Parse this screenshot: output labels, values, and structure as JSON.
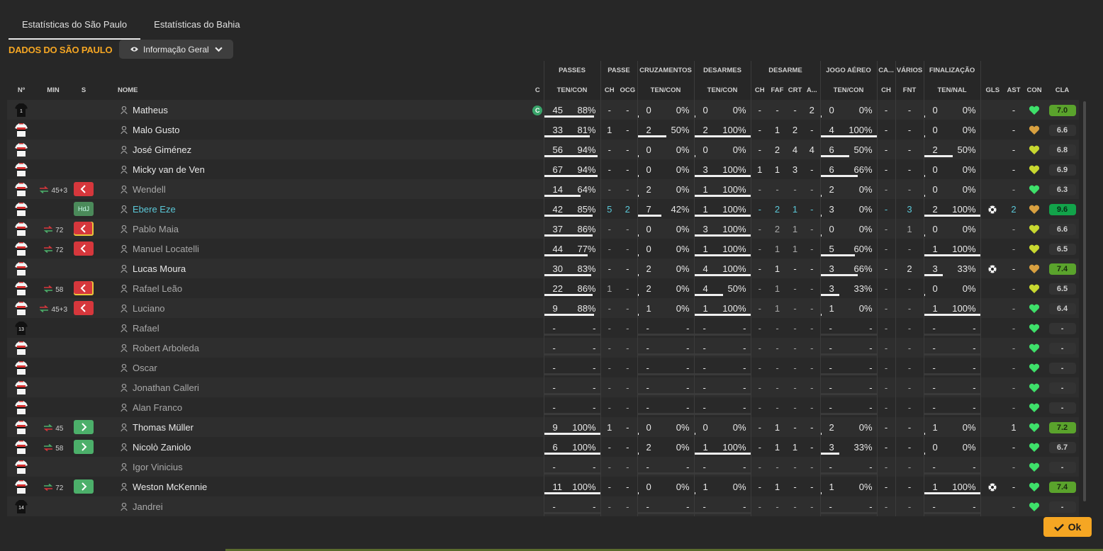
{
  "tabs": [
    "Estatísticas do São Paulo",
    "Estatísticas do Bahia"
  ],
  "section_title": "DADOS DO SÃO PAULO",
  "view_dropdown": "Informação Geral",
  "groups": [
    "PASSES",
    "PASSE",
    "CRUZAMENTOS",
    "DESARMES",
    "DESARME",
    "JOGO AÉREO",
    "CA...",
    "VÁRIOS",
    "FINALIZAÇÃO"
  ],
  "columns": {
    "num": "Nº",
    "min": "MIN",
    "s": "S",
    "name": "NOME",
    "c": "C",
    "passes": "TEN/CON",
    "passe_ch": "CH",
    "passe_ocg": "OCG",
    "cruz": "TEN/CON",
    "desarmes": "TEN/CON",
    "des_ch": "CH",
    "des_faf": "FAF",
    "des_crt": "CRT",
    "des_a": "A...",
    "aereo": "TEN/CON",
    "ca_ch": "CH",
    "fnt": "FNT",
    "final": "TEN/NAL",
    "gls": "GLS",
    "ast": "AST",
    "con": "CON",
    "cla": "CLA"
  },
  "players": [
    {
      "kit": "gk",
      "kitnum": "1",
      "arrow": "",
      "min": "",
      "sub": "",
      "name": "Matheus",
      "style": "",
      "cap": "C",
      "p1": "45",
      "p2": "88%",
      "pb": 88,
      "ch": "-",
      "ocg": "-",
      "c1": "0",
      "c2": "0%",
      "cb": 0,
      "d1": "0",
      "d2": "0%",
      "db": 0,
      "dch": "-",
      "faf": "-",
      "crt": "-",
      "da": "2",
      "a1": "0",
      "a2": "0%",
      "ab": 0,
      "cach": "-",
      "fnt": "-",
      "f1": "0",
      "f2": "0%",
      "fb": 0,
      "gls": "",
      "ast": "-",
      "con": "green",
      "cla": "7.0",
      "clac": "green"
    },
    {
      "kit": "out",
      "kitnum": "",
      "arrow": "",
      "min": "",
      "sub": "",
      "name": "Malo Gusto",
      "style": "",
      "cap": "",
      "p1": "33",
      "p2": "81%",
      "pb": 81,
      "ch": "1",
      "ocg": "-",
      "c1": "2",
      "c2": "50%",
      "cb": 50,
      "d1": "2",
      "d2": "100%",
      "db": 100,
      "dch": "-",
      "faf": "1",
      "crt": "2",
      "da": "-",
      "a1": "4",
      "a2": "100%",
      "ab": 100,
      "cach": "-",
      "fnt": "-",
      "f1": "0",
      "f2": "0%",
      "fb": 0,
      "gls": "",
      "ast": "-",
      "con": "orange",
      "cla": "6.6",
      "clac": "grey"
    },
    {
      "kit": "out",
      "kitnum": "",
      "arrow": "",
      "min": "",
      "sub": "",
      "name": "José Giménez",
      "style": "",
      "cap": "",
      "p1": "56",
      "p2": "94%",
      "pb": 94,
      "ch": "-",
      "ocg": "-",
      "c1": "0",
      "c2": "0%",
      "cb": 0,
      "d1": "0",
      "d2": "0%",
      "db": 0,
      "dch": "-",
      "faf": "2",
      "crt": "4",
      "da": "4",
      "a1": "6",
      "a2": "50%",
      "ab": 50,
      "cach": "-",
      "fnt": "-",
      "f1": "2",
      "f2": "50%",
      "fb": 50,
      "gls": "",
      "ast": "-",
      "con": "yellow",
      "cla": "6.8",
      "clac": "grey"
    },
    {
      "kit": "out",
      "kitnum": "",
      "arrow": "",
      "min": "",
      "sub": "",
      "name": "Micky van de Ven",
      "style": "",
      "cap": "",
      "p1": "67",
      "p2": "94%",
      "pb": 94,
      "ch": "-",
      "ocg": "-",
      "c1": "0",
      "c2": "0%",
      "cb": 0,
      "d1": "3",
      "d2": "100%",
      "db": 100,
      "dch": "1",
      "faf": "1",
      "crt": "3",
      "da": "-",
      "a1": "6",
      "a2": "66%",
      "ab": 66,
      "cach": "-",
      "fnt": "-",
      "f1": "0",
      "f2": "0%",
      "fb": 0,
      "gls": "",
      "ast": "-",
      "con": "yellow",
      "cla": "6.9",
      "clac": "grey"
    },
    {
      "kit": "out",
      "kitnum": "",
      "arrow": "red",
      "min": "45+3",
      "sub": "out",
      "name": "Wendell",
      "style": "dim",
      "cap": "",
      "p1": "14",
      "p2": "64%",
      "pb": 64,
      "ch": "-",
      "ocg": "-",
      "c1": "2",
      "c2": "0%",
      "cb": 0,
      "d1": "1",
      "d2": "100%",
      "db": 100,
      "dch": "-",
      "faf": "-",
      "crt": "-",
      "da": "-",
      "a1": "2",
      "a2": "0%",
      "ab": 0,
      "cach": "-",
      "fnt": "-",
      "f1": "0",
      "f2": "0%",
      "fb": 0,
      "gls": "",
      "ast": "-",
      "con": "green",
      "cla": "6.3",
      "clac": "grey"
    },
    {
      "kit": "out",
      "kitnum": "",
      "arrow": "",
      "min": "",
      "sub": "hdj",
      "name": "Ebere Eze",
      "style": "cyan",
      "cap": "",
      "p1": "42",
      "p2": "85%",
      "pb": 85,
      "ch": "5",
      "ocg": "2",
      "c1": "7",
      "c2": "42%",
      "cb": 42,
      "d1": "1",
      "d2": "100%",
      "db": 100,
      "dch": "-",
      "faf": "2",
      "crt": "1",
      "da": "-",
      "a1": "3",
      "a2": "0%",
      "ab": 0,
      "cach": "-",
      "fnt": "3",
      "f1": "2",
      "f2": "100%",
      "fb": 100,
      "gls": "ball",
      "ast": "2",
      "con": "orange",
      "cla": "9.6",
      "clac": "green2"
    },
    {
      "kit": "out",
      "kitnum": "",
      "arrow": "red",
      "min": "72",
      "sub": "out-yc",
      "name": "Pablo Maia",
      "style": "dim",
      "cap": "",
      "p1": "37",
      "p2": "86%",
      "pb": 86,
      "ch": "-",
      "ocg": "-",
      "c1": "0",
      "c2": "0%",
      "cb": 0,
      "d1": "3",
      "d2": "100%",
      "db": 100,
      "dch": "-",
      "faf": "2",
      "crt": "1",
      "da": "-",
      "a1": "0",
      "a2": "0%",
      "ab": 0,
      "cach": "-",
      "fnt": "1",
      "f1": "0",
      "f2": "0%",
      "fb": 0,
      "gls": "",
      "ast": "-",
      "con": "yellow",
      "cla": "6.6",
      "clac": "grey"
    },
    {
      "kit": "out",
      "kitnum": "",
      "arrow": "red",
      "min": "72",
      "sub": "out",
      "name": "Manuel Locatelli",
      "style": "dim",
      "cap": "",
      "p1": "44",
      "p2": "77%",
      "pb": 77,
      "ch": "-",
      "ocg": "-",
      "c1": "0",
      "c2": "0%",
      "cb": 0,
      "d1": "1",
      "d2": "100%",
      "db": 100,
      "dch": "-",
      "faf": "1",
      "crt": "1",
      "da": "-",
      "a1": "5",
      "a2": "60%",
      "ab": 60,
      "cach": "-",
      "fnt": "-",
      "f1": "1",
      "f2": "100%",
      "fb": 100,
      "gls": "",
      "ast": "-",
      "con": "yellow",
      "cla": "6.5",
      "clac": "grey"
    },
    {
      "kit": "out",
      "kitnum": "",
      "arrow": "",
      "min": "",
      "sub": "",
      "name": "Lucas Moura",
      "style": "",
      "cap": "",
      "p1": "30",
      "p2": "83%",
      "pb": 83,
      "ch": "-",
      "ocg": "-",
      "c1": "2",
      "c2": "0%",
      "cb": 0,
      "d1": "4",
      "d2": "100%",
      "db": 100,
      "dch": "-",
      "faf": "1",
      "crt": "-",
      "da": "-",
      "a1": "3",
      "a2": "66%",
      "ab": 66,
      "cach": "-",
      "fnt": "2",
      "f1": "3",
      "f2": "33%",
      "fb": 33,
      "gls": "ball",
      "ast": "-",
      "con": "orange",
      "cla": "7.4",
      "clac": "green"
    },
    {
      "kit": "out",
      "kitnum": "",
      "arrow": "red",
      "min": "58",
      "sub": "out-yc",
      "name": "Rafael Leão",
      "style": "dim",
      "cap": "",
      "p1": "22",
      "p2": "86%",
      "pb": 86,
      "ch": "1",
      "ocg": "-",
      "c1": "2",
      "c2": "0%",
      "cb": 0,
      "d1": "4",
      "d2": "50%",
      "db": 50,
      "dch": "-",
      "faf": "1",
      "crt": "-",
      "da": "-",
      "a1": "3",
      "a2": "33%",
      "ab": 33,
      "cach": "-",
      "fnt": "-",
      "f1": "0",
      "f2": "0%",
      "fb": 0,
      "gls": "",
      "ast": "-",
      "con": "yellow",
      "cla": "6.5",
      "clac": "grey"
    },
    {
      "kit": "out",
      "kitnum": "",
      "arrow": "red",
      "min": "45+3",
      "sub": "out",
      "name": "Luciano",
      "style": "dim",
      "cap": "",
      "p1": "9",
      "p2": "88%",
      "pb": 88,
      "ch": "-",
      "ocg": "-",
      "c1": "1",
      "c2": "0%",
      "cb": 0,
      "d1": "1",
      "d2": "100%",
      "db": 100,
      "dch": "-",
      "faf": "1",
      "crt": "-",
      "da": "-",
      "a1": "1",
      "a2": "0%",
      "ab": 0,
      "cach": "-",
      "fnt": "-",
      "f1": "1",
      "f2": "100%",
      "fb": 100,
      "gls": "",
      "ast": "-",
      "con": "green",
      "cla": "6.4",
      "clac": "grey"
    },
    {
      "kit": "gk",
      "kitnum": "13",
      "arrow": "",
      "min": "",
      "sub": "",
      "name": "Rafael",
      "style": "dim",
      "cap": "",
      "p1": "-",
      "p2": "-",
      "pb": 0,
      "ch": "-",
      "ocg": "-",
      "c1": "-",
      "c2": "-",
      "cb": 0,
      "d1": "-",
      "d2": "-",
      "db": 0,
      "dch": "-",
      "faf": "-",
      "crt": "-",
      "da": "-",
      "a1": "-",
      "a2": "-",
      "ab": 0,
      "cach": "-",
      "fnt": "-",
      "f1": "-",
      "f2": "-",
      "fb": 0,
      "gls": "",
      "ast": "-",
      "con": "green",
      "cla": "-",
      "clac": "grey"
    },
    {
      "kit": "out",
      "kitnum": "",
      "arrow": "",
      "min": "",
      "sub": "",
      "name": "Robert Arboleda",
      "style": "dim",
      "cap": "",
      "p1": "-",
      "p2": "-",
      "pb": 0,
      "ch": "-",
      "ocg": "-",
      "c1": "-",
      "c2": "-",
      "cb": 0,
      "d1": "-",
      "d2": "-",
      "db": 0,
      "dch": "-",
      "faf": "-",
      "crt": "-",
      "da": "-",
      "a1": "-",
      "a2": "-",
      "ab": 0,
      "cach": "-",
      "fnt": "-",
      "f1": "-",
      "f2": "-",
      "fb": 0,
      "gls": "",
      "ast": "-",
      "con": "green",
      "cla": "-",
      "clac": "grey"
    },
    {
      "kit": "out",
      "kitnum": "",
      "arrow": "",
      "min": "",
      "sub": "",
      "name": "Oscar",
      "style": "dim",
      "cap": "",
      "p1": "-",
      "p2": "-",
      "pb": 0,
      "ch": "-",
      "ocg": "-",
      "c1": "-",
      "c2": "-",
      "cb": 0,
      "d1": "-",
      "d2": "-",
      "db": 0,
      "dch": "-",
      "faf": "-",
      "crt": "-",
      "da": "-",
      "a1": "-",
      "a2": "-",
      "ab": 0,
      "cach": "-",
      "fnt": "-",
      "f1": "-",
      "f2": "-",
      "fb": 0,
      "gls": "",
      "ast": "-",
      "con": "green",
      "cla": "-",
      "clac": "grey"
    },
    {
      "kit": "out",
      "kitnum": "",
      "arrow": "",
      "min": "",
      "sub": "",
      "name": "Jonathan Calleri",
      "style": "dim",
      "cap": "",
      "p1": "-",
      "p2": "-",
      "pb": 0,
      "ch": "-",
      "ocg": "-",
      "c1": "-",
      "c2": "-",
      "cb": 0,
      "d1": "-",
      "d2": "-",
      "db": 0,
      "dch": "-",
      "faf": "-",
      "crt": "-",
      "da": "-",
      "a1": "-",
      "a2": "-",
      "ab": 0,
      "cach": "-",
      "fnt": "-",
      "f1": "-",
      "f2": "-",
      "fb": 0,
      "gls": "",
      "ast": "-",
      "con": "green",
      "cla": "-",
      "clac": "grey"
    },
    {
      "kit": "out",
      "kitnum": "",
      "arrow": "",
      "min": "",
      "sub": "",
      "name": "Alan Franco",
      "style": "dim",
      "cap": "",
      "p1": "-",
      "p2": "-",
      "pb": 0,
      "ch": "-",
      "ocg": "-",
      "c1": "-",
      "c2": "-",
      "cb": 0,
      "d1": "-",
      "d2": "-",
      "db": 0,
      "dch": "-",
      "faf": "-",
      "crt": "-",
      "da": "-",
      "a1": "-",
      "a2": "-",
      "ab": 0,
      "cach": "-",
      "fnt": "-",
      "f1": "-",
      "f2": "-",
      "fb": 0,
      "gls": "",
      "ast": "-",
      "con": "green",
      "cla": "-",
      "clac": "grey"
    },
    {
      "kit": "out",
      "kitnum": "",
      "arrow": "green",
      "min": "45",
      "sub": "in",
      "name": "Thomas Müller",
      "style": "",
      "cap": "",
      "p1": "9",
      "p2": "100%",
      "pb": 100,
      "ch": "1",
      "ocg": "-",
      "c1": "0",
      "c2": "0%",
      "cb": 0,
      "d1": "0",
      "d2": "0%",
      "db": 0,
      "dch": "-",
      "faf": "1",
      "crt": "-",
      "da": "-",
      "a1": "2",
      "a2": "0%",
      "ab": 0,
      "cach": "-",
      "fnt": "-",
      "f1": "1",
      "f2": "0%",
      "fb": 0,
      "gls": "",
      "ast": "1",
      "con": "green",
      "cla": "7.2",
      "clac": "green"
    },
    {
      "kit": "out",
      "kitnum": "",
      "arrow": "green",
      "min": "58",
      "sub": "in",
      "name": "Nicolò Zaniolo",
      "style": "",
      "cap": "",
      "p1": "6",
      "p2": "100%",
      "pb": 100,
      "ch": "-",
      "ocg": "-",
      "c1": "2",
      "c2": "0%",
      "cb": 0,
      "d1": "1",
      "d2": "100%",
      "db": 100,
      "dch": "-",
      "faf": "1",
      "crt": "1",
      "da": "-",
      "a1": "3",
      "a2": "33%",
      "ab": 33,
      "cach": "-",
      "fnt": "-",
      "f1": "0",
      "f2": "0%",
      "fb": 0,
      "gls": "",
      "ast": "-",
      "con": "green",
      "cla": "6.7",
      "clac": "grey"
    },
    {
      "kit": "out",
      "kitnum": "",
      "arrow": "",
      "min": "",
      "sub": "",
      "name": "Igor Vinicius",
      "style": "dim",
      "cap": "",
      "p1": "-",
      "p2": "-",
      "pb": 0,
      "ch": "-",
      "ocg": "-",
      "c1": "-",
      "c2": "-",
      "cb": 0,
      "d1": "-",
      "d2": "-",
      "db": 0,
      "dch": "-",
      "faf": "-",
      "crt": "-",
      "da": "-",
      "a1": "-",
      "a2": "-",
      "ab": 0,
      "cach": "-",
      "fnt": "-",
      "f1": "-",
      "f2": "-",
      "fb": 0,
      "gls": "",
      "ast": "-",
      "con": "green",
      "cla": "-",
      "clac": "grey"
    },
    {
      "kit": "out",
      "kitnum": "",
      "arrow": "green",
      "min": "72",
      "sub": "in",
      "name": "Weston McKennie",
      "style": "",
      "cap": "",
      "p1": "11",
      "p2": "100%",
      "pb": 100,
      "ch": "-",
      "ocg": "-",
      "c1": "0",
      "c2": "0%",
      "cb": 0,
      "d1": "1",
      "d2": "0%",
      "db": 0,
      "dch": "-",
      "faf": "1",
      "crt": "-",
      "da": "-",
      "a1": "1",
      "a2": "0%",
      "ab": 0,
      "cach": "-",
      "fnt": "-",
      "f1": "1",
      "f2": "100%",
      "fb": 100,
      "gls": "ball",
      "ast": "-",
      "con": "green",
      "cla": "7.4",
      "clac": "green"
    },
    {
      "kit": "gk",
      "kitnum": "14",
      "arrow": "",
      "min": "",
      "sub": "",
      "name": "Jandrei",
      "style": "dim",
      "cap": "",
      "p1": "-",
      "p2": "-",
      "pb": 0,
      "ch": "-",
      "ocg": "-",
      "c1": "-",
      "c2": "-",
      "cb": 0,
      "d1": "-",
      "d2": "-",
      "db": 0,
      "dch": "-",
      "faf": "-",
      "crt": "-",
      "da": "-",
      "a1": "-",
      "a2": "-",
      "ab": 0,
      "cach": "-",
      "fnt": "-",
      "f1": "-",
      "f2": "-",
      "fb": 0,
      "gls": "",
      "ast": "-",
      "con": "green",
      "cla": "-",
      "clac": "grey"
    }
  ],
  "ok_label": "Ok",
  "colors": {
    "accent": "#f5a623",
    "sub_out": "#d6373c",
    "sub_in": "#4caf6a",
    "rating_green": "#5aa32c",
    "rating_best": "#12a34a"
  }
}
